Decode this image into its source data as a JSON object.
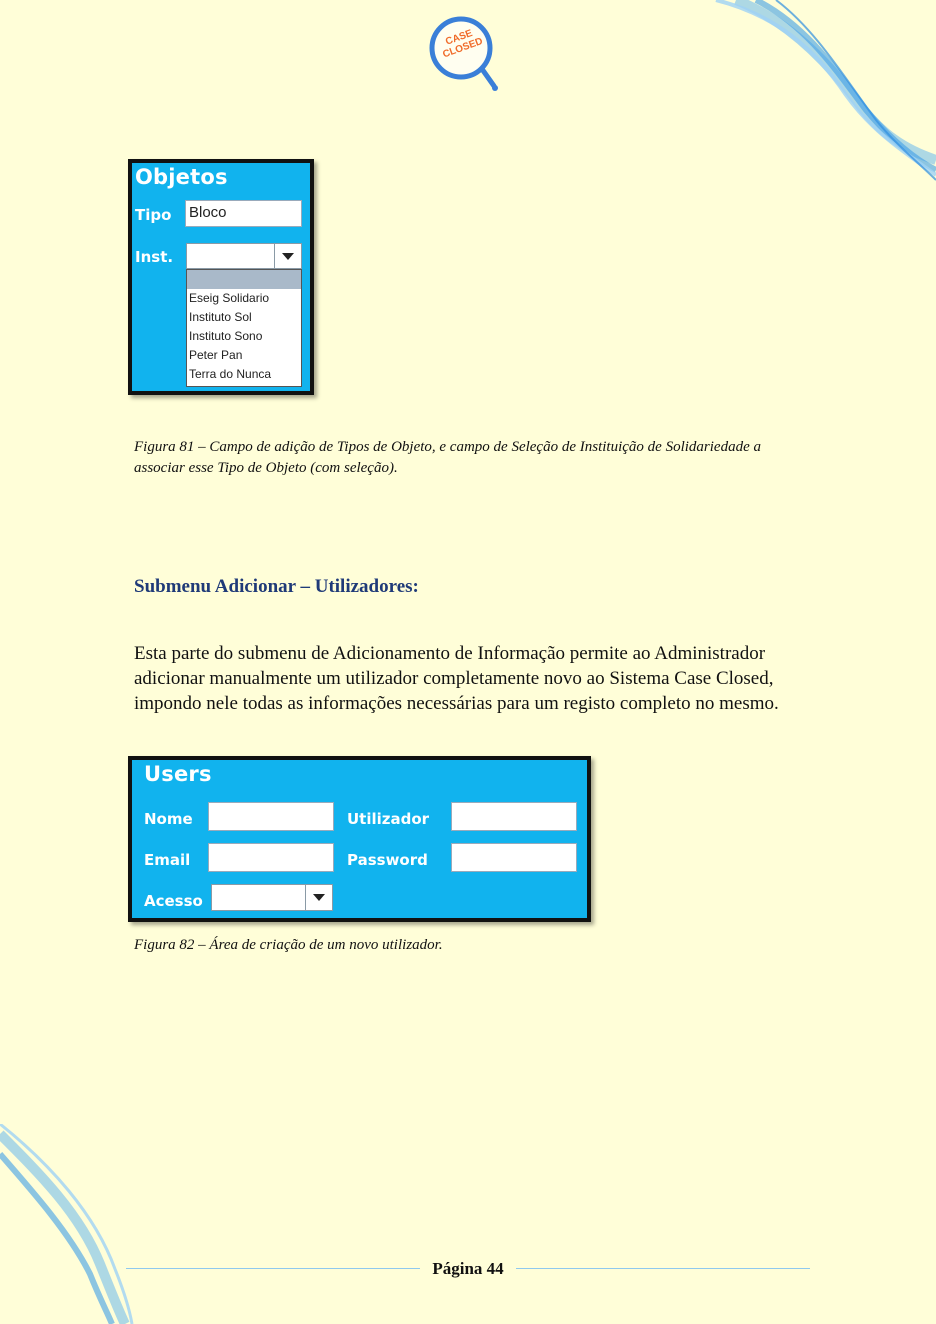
{
  "logo": {
    "line1": "CASE",
    "line2": "CLOSED"
  },
  "figure81": {
    "panel_title": "Objetos",
    "tipo_label": "Tipo",
    "tipo_value": "Bloco",
    "inst_label": "Inst.",
    "inst_selected": "",
    "options": [
      "Eseig Solidario",
      "Instituto Sol",
      "Instituto Sono",
      "Peter Pan",
      "Terra do Nunca"
    ],
    "caption": "Figura 81 – Campo de adição de Tipos de Objeto, e campo de Seleção de Instituição de Solidariedade a associar esse Tipo de Objeto (com seleção)."
  },
  "section": {
    "heading": "Submenu Adicionar – Utilizadores:",
    "body": "Esta parte do submenu de Adicionamento de Informação permite ao Administrador adicionar manualmente um utilizador completamente novo ao Sistema Case Closed, impondo nele todas as informações necessárias para um registo completo no mesmo."
  },
  "figure82": {
    "panel_title": "Users",
    "nome_label": "Nome",
    "email_label": "Email",
    "acesso_label": "Acesso",
    "utilizador_label": "Utilizador",
    "password_label": "Password",
    "caption": "Figura 82 – Área de criação de um novo utilizador."
  },
  "footer": {
    "page_label": "Página 44"
  },
  "colors": {
    "page_bg": "#fffed8",
    "panel_blue": "#11b3ee",
    "heading": "#1f3a78",
    "logo_ring": "#3a7fd8",
    "logo_text": "#f06b2a"
  }
}
